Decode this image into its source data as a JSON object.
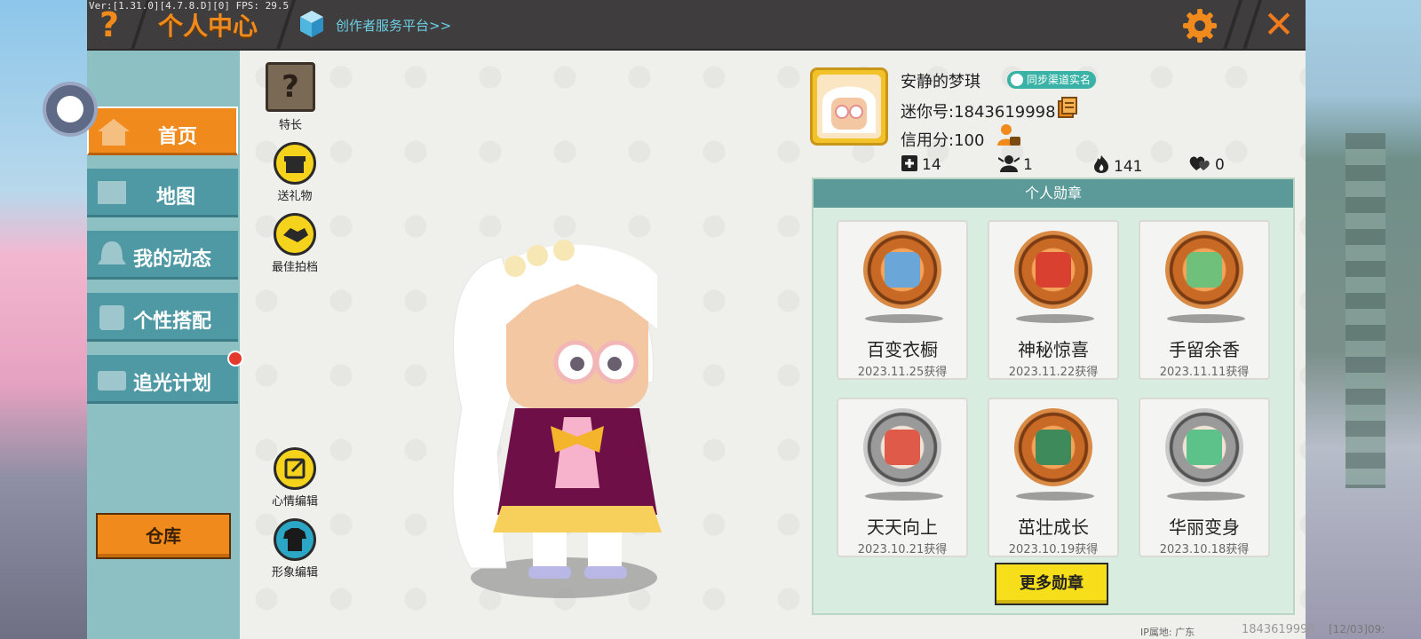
{
  "debug": {
    "version": "Ver:[1.31.0][4.7.8.D][0] FPS: 29.5"
  },
  "topbar": {
    "title": "个人中心",
    "creator_link": "创作者服务平台>>",
    "help_glyph": "?",
    "close_glyph": "✕"
  },
  "nav": {
    "items": [
      {
        "label": "首页",
        "icon": "house-icon",
        "active": true
      },
      {
        "label": "地图",
        "icon": "map-icon"
      },
      {
        "label": "我的动态",
        "icon": "bell-icon"
      },
      {
        "label": "个性搭配",
        "icon": "outfit-icon"
      },
      {
        "label": "追光计划",
        "icon": "camera-icon",
        "notification": true
      }
    ],
    "warehouse": "仓库"
  },
  "side_actions": {
    "specialty": {
      "label": "特长",
      "glyph": "?"
    },
    "gift": {
      "label": "送礼物"
    },
    "partner": {
      "label": "最佳拍档"
    },
    "mood_edit": {
      "label": "心情编辑"
    },
    "avatar_edit": {
      "label": "形象编辑"
    }
  },
  "profile": {
    "name": "安静的梦琪",
    "sync_badge": "同步渠道实名",
    "mini_id": "迷你号:1843619998",
    "credit": "信用分:100",
    "stats": [
      {
        "icon": "plus-square-icon",
        "value": "14"
      },
      {
        "icon": "fans-icon",
        "value": "1"
      },
      {
        "icon": "flame-icon",
        "value": "141"
      },
      {
        "icon": "heart-icon",
        "value": "0"
      }
    ]
  },
  "medals": {
    "header": "个人勋章",
    "items": [
      {
        "name": "百变衣橱",
        "date": "2023.11.25获得",
        "tier": "bronze",
        "accent": "#6aa7d8"
      },
      {
        "name": "神秘惊喜",
        "date": "2023.11.22获得",
        "tier": "bronze",
        "accent": "#d94030"
      },
      {
        "name": "手留余香",
        "date": "2023.11.11获得",
        "tier": "bronze",
        "accent": "#6fc07a"
      },
      {
        "name": "天天向上",
        "date": "2023.10.21获得",
        "tier": "silver",
        "accent": "#e05a4a"
      },
      {
        "name": "茁壮成长",
        "date": "2023.10.19获得",
        "tier": "bronze",
        "accent": "#3f8a5a"
      },
      {
        "name": "华丽变身",
        "date": "2023.10.18获得",
        "tier": "silver",
        "accent": "#5cc28a"
      }
    ],
    "more_button": "更多勋章"
  },
  "footer": {
    "ip": "IP属地: 广东",
    "id": "1843619998",
    "time": "[12/03]09:"
  },
  "colors": {
    "accent": "#f08a1c",
    "nav": "#4f99a5",
    "medal_header": "#5b9a98"
  }
}
